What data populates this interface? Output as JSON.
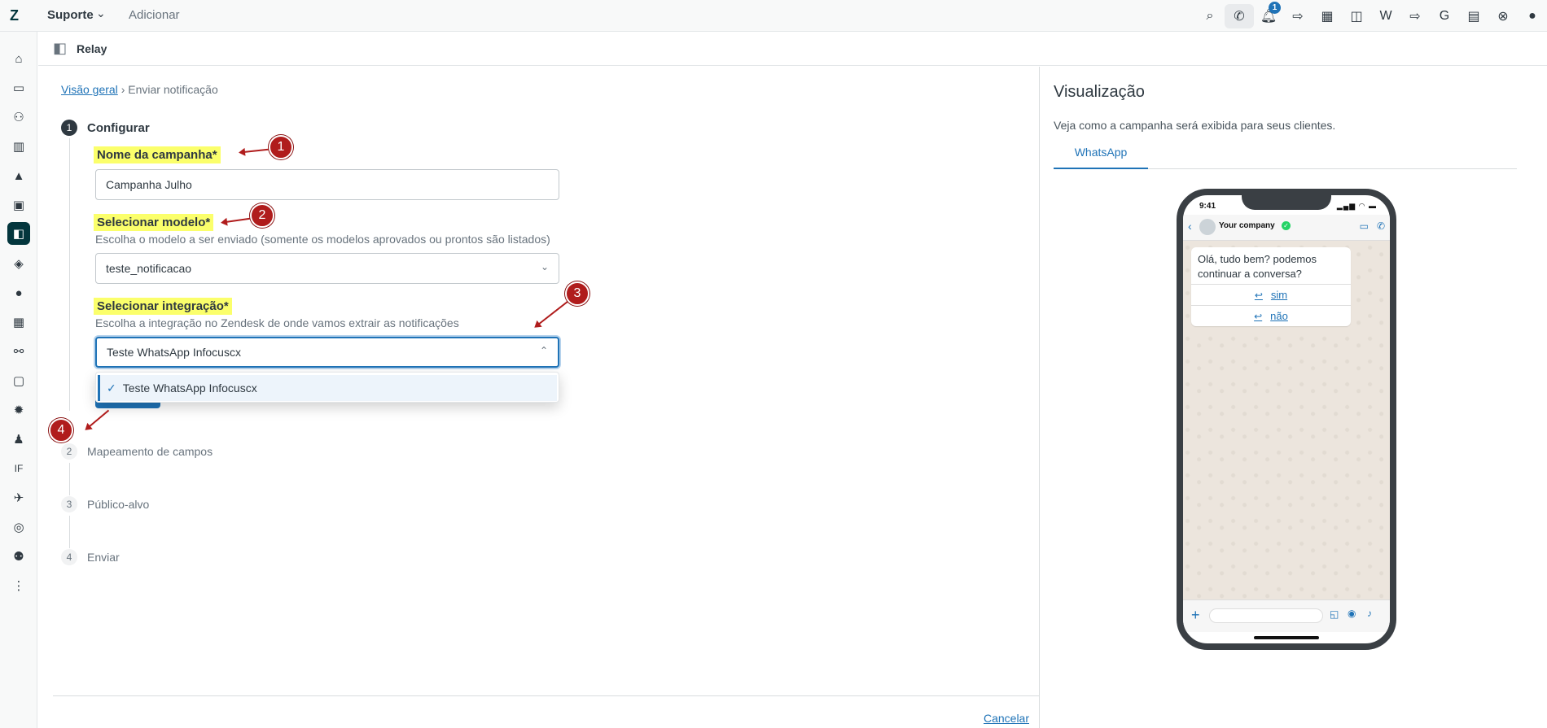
{
  "topbar": {
    "brand": "Suporte",
    "add_label": "Adicionar",
    "notification_count": "1",
    "icons": [
      "search-icon",
      "phone-icon",
      "bell-icon",
      "app-icon-1",
      "app-icon-2",
      "app-icon-3",
      "app-icon-4",
      "app-icon-5",
      "app-icon-6",
      "app-icon-7",
      "help-icon",
      "avatar"
    ]
  },
  "sidebar": {
    "icons": [
      "home-icon",
      "inbox-icon",
      "users-icon",
      "building-icon",
      "shapes-icon",
      "tray-icon",
      "relay-app-icon",
      "box-icon",
      "dot-icon",
      "form-icon",
      "binoculars-icon",
      "chat-icon",
      "gear-icon",
      "person-icon",
      "if-icon",
      "plane-icon",
      "whatsapp-icon",
      "team-icon",
      "more-icon"
    ],
    "if_label": "IF"
  },
  "app": {
    "title": "Relay"
  },
  "breadcrumb": {
    "root": "Visão geral",
    "separator": "›",
    "current": "Enviar notificação"
  },
  "steps": [
    {
      "num": "1",
      "label": "Configurar"
    },
    {
      "num": "2",
      "label": "Mapeamento de campos"
    },
    {
      "num": "3",
      "label": "Público-alvo"
    },
    {
      "num": "4",
      "label": "Enviar"
    }
  ],
  "form": {
    "campaign_label": "Nome da campanha*",
    "campaign_value": "Campanha Julho",
    "template_label": "Selecionar modelo*",
    "template_hint": "Escolha o modelo a ser enviado (somente os modelos aprovados ou prontos são listados)",
    "template_value": "teste_notificacao",
    "integration_label": "Selecionar integração*",
    "integration_hint": "Escolha a integração no Zendesk de onde vamos extrair as notificações",
    "integration_value": "Teste WhatsApp Infocuscx",
    "dropdown_option": "Teste WhatsApp Infocuscx"
  },
  "markers": [
    "1",
    "2",
    "3",
    "4"
  ],
  "footer": {
    "cancel": "Cancelar"
  },
  "preview": {
    "title": "Visualização",
    "subtitle": "Veja como a campanha será exibida para seus clientes.",
    "tab": "WhatsApp",
    "phone": {
      "time": "9:41",
      "company": "Your company",
      "message": "Olá, tudo bem? podemos continuar a conversa?",
      "buttons": [
        "sim",
        "não"
      ]
    }
  },
  "colors": {
    "accent": "#1f73b7",
    "highlight": "#fbff6b",
    "marker": "#b01c1c"
  }
}
